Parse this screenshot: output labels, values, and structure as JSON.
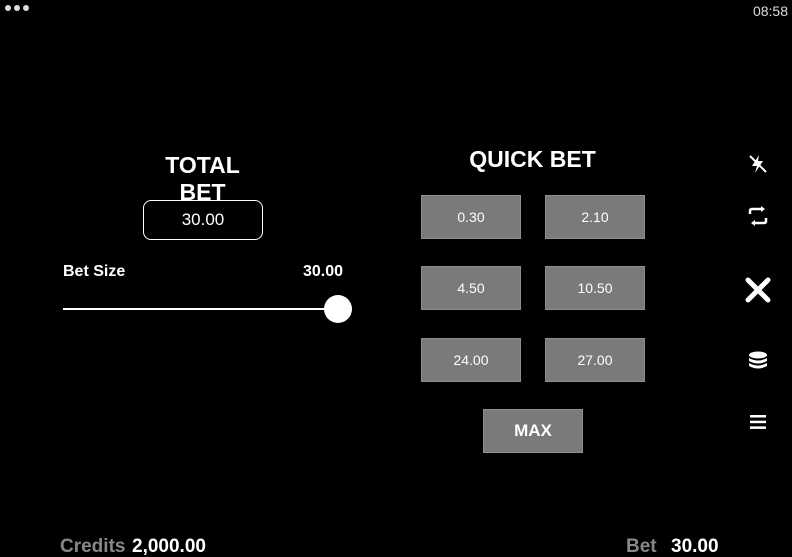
{
  "status": {
    "time": "08:58"
  },
  "total_bet": {
    "title": "TOTAL BET",
    "value": "30.00"
  },
  "bet_size": {
    "label": "Bet Size",
    "value": "30.00",
    "slider_level_fraction": 1.0
  },
  "quick_bet": {
    "title": "QUICK BET",
    "options": [
      "0.30",
      "2.10",
      "4.50",
      "10.50",
      "24.00",
      "27.00"
    ],
    "max_label": "MAX"
  },
  "side_icons": [
    "lightning-icon",
    "autoplay-icon",
    "close-icon",
    "coins-icon",
    "menu-icon"
  ],
  "footer": {
    "credits_label": "Credits",
    "credits_value": "2,000.00",
    "bet_label": "Bet",
    "bet_value": "30.00"
  },
  "colors": {
    "background": "#000000",
    "button": "#7a7a7a",
    "text": "#ffffff",
    "muted": "#888888"
  }
}
